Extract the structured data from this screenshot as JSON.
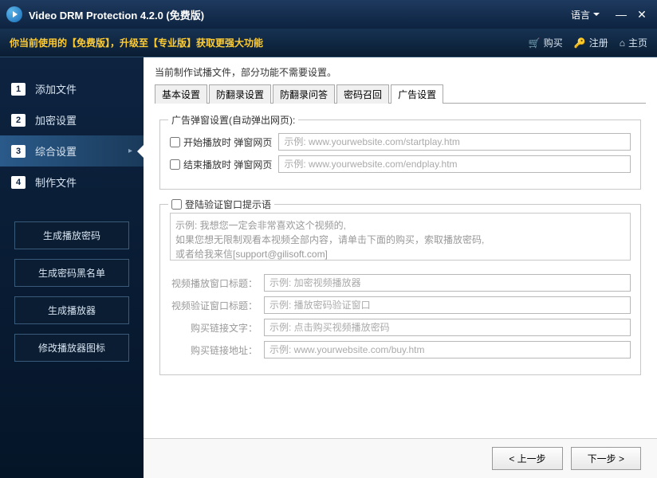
{
  "window": {
    "title": "Video DRM Protection 4.2.0 (免费版)",
    "language": "语言"
  },
  "toolbar": {
    "notice": "你当前使用的【免费版】，升级至【专业版】获取更强大功能",
    "buy": "购买",
    "register": "注册",
    "home": "主页"
  },
  "sidebar": {
    "steps": [
      {
        "num": "1",
        "label": "添加文件"
      },
      {
        "num": "2",
        "label": "加密设置"
      },
      {
        "num": "3",
        "label": "综合设置"
      },
      {
        "num": "4",
        "label": "制作文件"
      }
    ],
    "buttons": {
      "gen_pwd": "生成播放密码",
      "gen_blacklist": "生成密码黑名单",
      "gen_player": "生成播放器",
      "mod_icon": "修改播放器图标"
    }
  },
  "main": {
    "hint": "当前制作试播文件，部分功能不需要设置。",
    "tabs": {
      "basic": "基本设置",
      "anti_rec": "防翻录设置",
      "anti_qa": "防翻录问答",
      "pwd_recall": "密码召回",
      "ad": "广告设置"
    },
    "ad": {
      "popup_legend": "广告弹窗设置(自动弹出网页):",
      "start_label": "开始播放时 弹窗网页",
      "start_ph": "示例: www.yourwebsite.com/startplay.htm",
      "end_label": "结束播放时 弹窗网页",
      "end_ph": "示例: www.yourwebsite.com/endplay.htm",
      "login_legend": "登陆验证窗口提示语",
      "login_text": "示例: 我想您一定会非常喜欢这个视频的,\n如果您想无限制观看本视频全部内容，请单击下面的购买，索取播放密码,\n或者给我来信[support@gilisoft.com]",
      "play_title_lbl": "视频播放窗口标题：",
      "play_title_ph": "示例: 加密视频播放器",
      "verify_title_lbl": "视频验证窗口标题：",
      "verify_title_ph": "示例: 播放密码验证窗口",
      "buy_text_lbl": "购买链接文字：",
      "buy_text_ph": "示例: 点击购买视频播放密码",
      "buy_url_lbl": "购买链接地址：",
      "buy_url_ph": "示例: www.yourwebsite.com/buy.htm"
    }
  },
  "footer": {
    "prev": "< 上一步",
    "next": "下一步 >"
  }
}
